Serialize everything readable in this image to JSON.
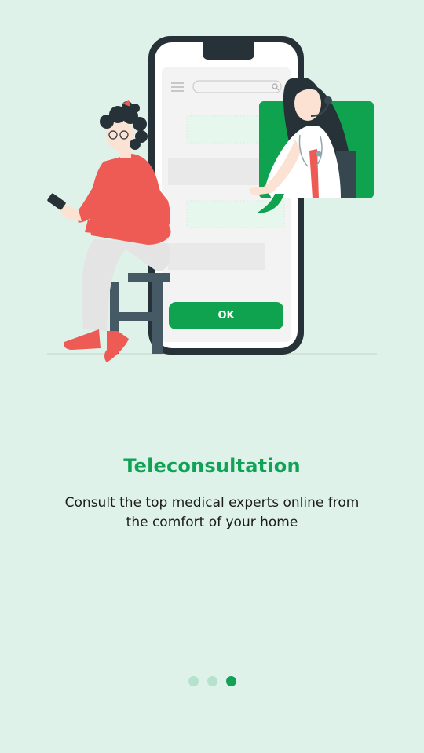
{
  "onboarding": {
    "title": "Teleconsultation",
    "description": "Consult the top medical experts online from the comfort of your home",
    "total_pages": 3,
    "current_page": 3
  },
  "illustration": {
    "ok_button_label": "OK",
    "icons": [
      "menu-icon",
      "search-icon",
      "headset-icon",
      "stethoscope-icon",
      "speech-bubble-icon"
    ]
  },
  "colors": {
    "background": "#dff2ea",
    "accent": "#10a255",
    "dot_inactive": "#b6e2cd",
    "phone_frame": "#263238",
    "shirt": "#ee5b55"
  }
}
